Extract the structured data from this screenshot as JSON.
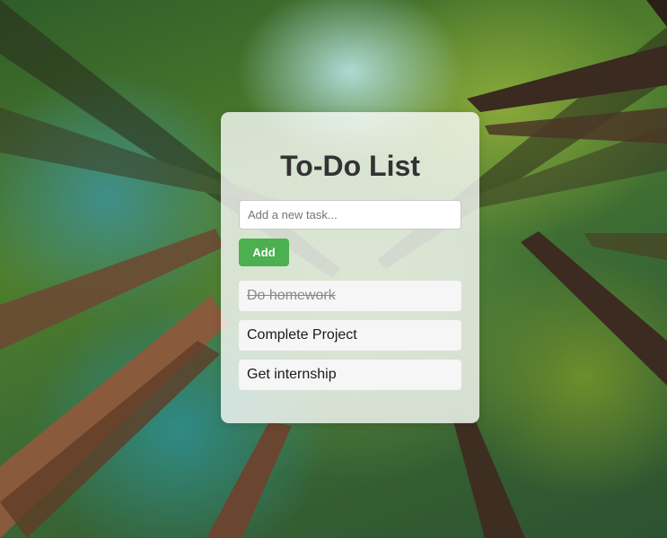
{
  "app": {
    "title": "To-Do List"
  },
  "new_task": {
    "placeholder": "Add a new task...",
    "value": ""
  },
  "add_button": {
    "label": "Add",
    "color": "#4caf50"
  },
  "tasks": [
    {
      "text": "Do homework",
      "completed": true
    },
    {
      "text": "Complete Project",
      "completed": false
    },
    {
      "text": "Get internship",
      "completed": false
    }
  ]
}
